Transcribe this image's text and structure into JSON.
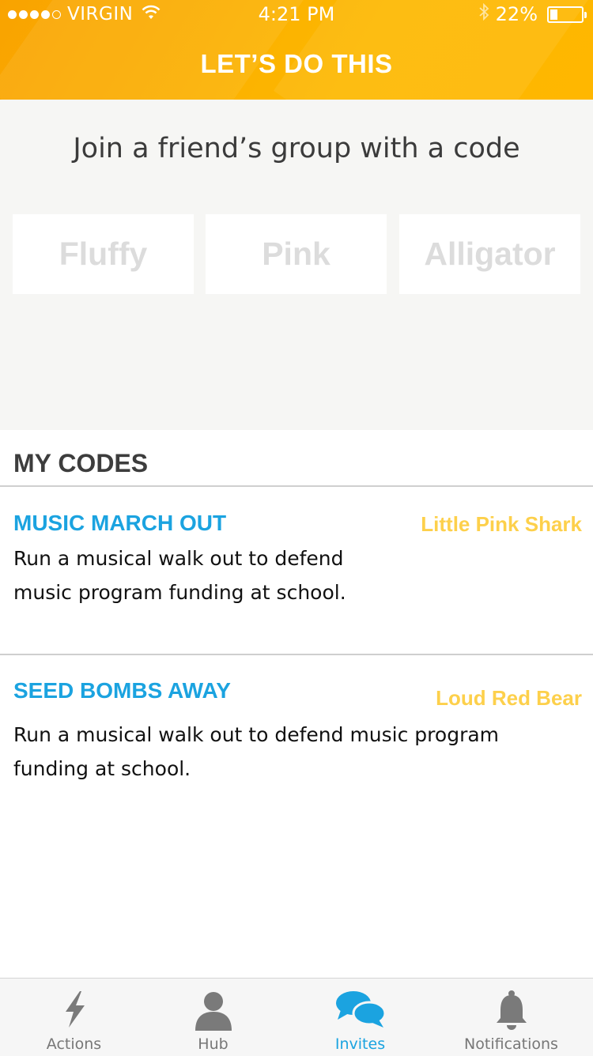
{
  "status_bar": {
    "carrier": "VIRGIN",
    "time": "4:21 PM",
    "battery": "22%"
  },
  "header": {
    "title": "LET’S DO THIS"
  },
  "join": {
    "title": "Join a friend’s group with a code",
    "code_words": [
      "Fluffy",
      "Pink",
      "Alligator"
    ]
  },
  "my_codes": {
    "title": "MY CODES",
    "items": [
      {
        "title": "MUSIC MARCH OUT",
        "code": "Little Pink Shark",
        "description": "Run a musical walk out to defend music program funding at school."
      },
      {
        "title": "SEED BOMBS AWAY",
        "code": "Loud Red Bear",
        "description": "Run a musical walk out to defend music program funding at school."
      }
    ]
  },
  "tabbar": {
    "tabs": [
      {
        "label": "Actions",
        "icon": "lightning-icon"
      },
      {
        "label": "Hub",
        "icon": "person-icon"
      },
      {
        "label": "Invites",
        "icon": "chat-bubbles-icon"
      },
      {
        "label": "Notifications",
        "icon": "bell-icon"
      }
    ],
    "active": "Invites"
  },
  "colors": {
    "header": "#fbb100",
    "accent_blue": "#1ba3e0",
    "code_yellow": "#fdd04b"
  }
}
